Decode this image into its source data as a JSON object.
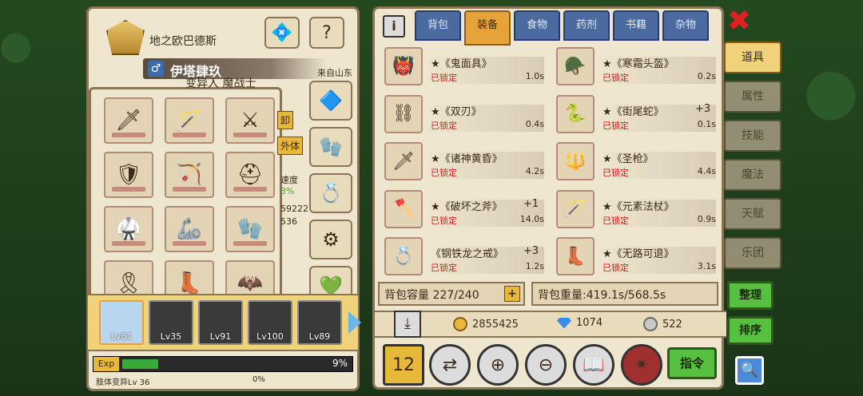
{
  "character": {
    "title": "地之欧巴德斯",
    "name": "伊塔肆玖",
    "gender_symbol": "♂",
    "origin": "来自山东",
    "class": "变异人 魔战士",
    "side_tags": [
      "卸",
      "外体"
    ],
    "side_stats": [
      "速度",
      "3%",
      "59222",
      "536"
    ]
  },
  "equipment_slots": [
    "sword-icon",
    "staff-icon",
    "scythe-icon",
    "armor-icon",
    "bow-icon",
    "helm-icon",
    "chest-icon",
    "claw-icon",
    "gauntlet-icon",
    "belt-icon",
    "boots-icon",
    "cape-icon"
  ],
  "accessory_slots": [
    "amulet-icon",
    "glove-icon",
    "ring-icon",
    "bracer-icon",
    "ring2-icon"
  ],
  "party": [
    {
      "level": "Lv81",
      "active": true
    },
    {
      "level": "Lv35",
      "active": false
    },
    {
      "level": "Lv91",
      "active": false
    },
    {
      "level": "Lv100",
      "active": false
    },
    {
      "level": "Lv89",
      "active": false
    }
  ],
  "exp": {
    "label": "Exp",
    "percent": "9%",
    "fill": 0.09
  },
  "mutation": {
    "label": "肢体变异Lv 36",
    "percent": "0%"
  },
  "inventory": {
    "tabs": [
      "背包",
      "装备",
      "食物",
      "药剂",
      "书籍",
      "杂物"
    ],
    "active_tab": 1,
    "items": [
      {
        "name": "★《鬼面具》",
        "plus": "",
        "lock": "已锁定",
        "weight": "1.0s",
        "icon": "mask-icon"
      },
      {
        "name": "★《寒霜头盔》",
        "plus": "",
        "lock": "已锁定",
        "weight": "0.2s",
        "icon": "helmet-icon"
      },
      {
        "name": "★《双刃》",
        "plus": "",
        "lock": "已锁定",
        "weight": "0.4s",
        "icon": "blades-icon"
      },
      {
        "name": "★《街尾蛇》",
        "plus": "+3",
        "lock": "已锁定",
        "weight": "0.1s",
        "icon": "snake-icon"
      },
      {
        "name": "★《诸神黄昏》",
        "plus": "",
        "lock": "已锁定",
        "weight": "4.2s",
        "icon": "greatsword-icon"
      },
      {
        "name": "★《圣枪》",
        "plus": "",
        "lock": "已锁定",
        "weight": "4.4s",
        "icon": "spear-icon"
      },
      {
        "name": "★《破坏之斧》",
        "plus": "+1",
        "lock": "已锁定",
        "weight": "14.0s",
        "icon": "axe-icon"
      },
      {
        "name": "★《元素法杖》",
        "plus": "",
        "lock": "已锁定",
        "weight": "0.9s",
        "icon": "wand-icon"
      },
      {
        "name": "《钢铁龙之戒》",
        "plus": "+3",
        "lock": "已锁定",
        "weight": "1.2s",
        "icon": "ring-icon"
      },
      {
        "name": "★《无路可退》",
        "plus": "",
        "lock": "已锁定",
        "weight": "3.1s",
        "icon": "boot-icon"
      }
    ],
    "capacity": "背包容量 227/240",
    "weight": "背包重量:419.1s/568.5s"
  },
  "currency": {
    "gold": "2855425",
    "diamond": "1074",
    "silver": "522"
  },
  "side_menu": [
    "道具",
    "属性",
    "技能",
    "魔法",
    "天赋",
    "乐团"
  ],
  "actions": {
    "sort": "整理",
    "order": "排序",
    "command": "指令"
  },
  "colors": {
    "accent": "#e8a23a",
    "lock": "#c81e1e",
    "confirm": "#58c040"
  }
}
